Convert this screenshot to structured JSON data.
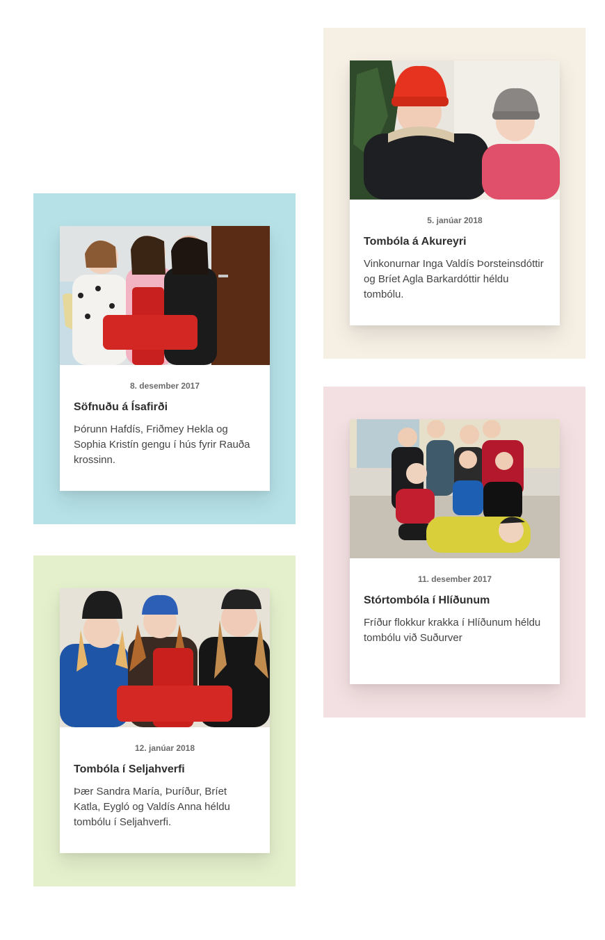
{
  "posts": [
    {
      "date": "5. janúar 2018",
      "title": "Tombóla á Akureyri",
      "excerpt": "Vinkonurnar Inga Valdís Þorsteinsdóttir og Bríet Agla Barkardóttir héldu tombólu.",
      "background_color": "#f6efe4"
    },
    {
      "date": "8. desember 2017",
      "title": "Söfnuðu á Ísafirði",
      "excerpt": "Þórunn Hafdís, Friðmey Hekla og Sophia Kristín gengu í hús fyrir Rauða krossinn.",
      "background_color": "#b5e1e7"
    },
    {
      "date": "11. desember 2017",
      "title": "Stórtombóla í Hlíðunum",
      "excerpt": "Fríður flokkur krakka í Hlíðunum héldu tombólu við Suðurver",
      "background_color": "#f3e0e2"
    },
    {
      "date": "12. janúar 2018",
      "title": "Tombóla í Seljahverfi",
      "excerpt": "Þær Sandra María, Þuríður, Bríet Katla, Eygló og Valdís Anna héldu tombólu í Seljahverfi.",
      "background_color": "#e4f0cc"
    }
  ]
}
